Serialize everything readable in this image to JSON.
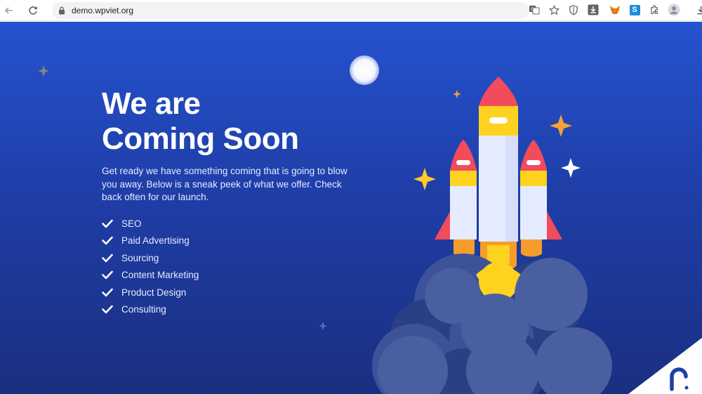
{
  "browser": {
    "url": "demo.wpviet.org",
    "icons": [
      "back-arrow-icon",
      "reload-icon",
      "lock-icon",
      "translate-icon",
      "bookmark-star-icon",
      "shield-icon",
      "download-ext-icon",
      "fox-extension-icon",
      "s-extension-icon",
      "puzzle-extensions-icon",
      "profile-avatar",
      "downloads-icon"
    ],
    "ext_s_label": "S"
  },
  "hero": {
    "title_line1": "We are",
    "title_line2": "Coming Soon",
    "description": "Get ready we have something coming that is going to blow you away. Below is a sneak peek of what we offer. Check back often for our launch.",
    "features": [
      "SEO",
      "Paid Advertising",
      "Sourcing",
      "Content Marketing",
      "Product Design",
      "Consulting"
    ]
  },
  "colors": {
    "bg_top": "#2553cf",
    "bg_bottom": "#1a2f80",
    "rocket_body": "#e6ecff",
    "rocket_red": "#f24b5c",
    "rocket_yellow": "#ffd21f",
    "smoke": "#4a5fa0",
    "star_gold": "#f7b733"
  }
}
